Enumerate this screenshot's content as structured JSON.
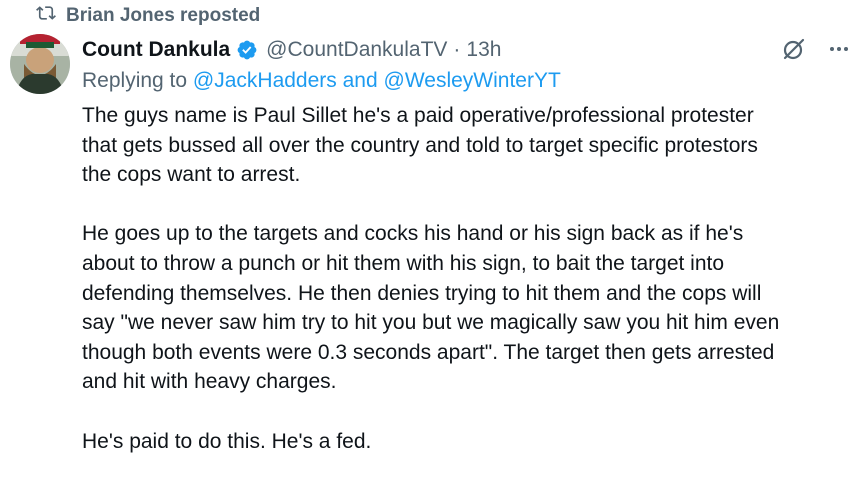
{
  "repost": {
    "icon": "repost-icon",
    "label": "Brian Jones reposted"
  },
  "author": {
    "name": "Count Dankula",
    "verified_icon": "verified-badge-icon",
    "handle": "@CountDankulaTV",
    "separator": "·",
    "time": "13h"
  },
  "header_icons": [
    "grok-icon",
    "more-icon"
  ],
  "reply": {
    "prefix": "Replying to ",
    "user1": "@JackHadders",
    "conjunction": " and ",
    "user2": "@WesleyWinterYT"
  },
  "tweet": {
    "paragraphs": [
      {
        "lines": [
          "The guys name is Paul Sillet he's a paid operative/professional protester",
          "that gets bussed all over the country and told to target specific protestors",
          "the cops want to arrest."
        ]
      },
      {
        "lines": [
          "He goes up to the targets and cocks his hand or his sign back as if he's",
          "about to throw a punch or hit them with his sign, to bait the target into",
          "defending themselves. He then denies trying to hit them and the cops will",
          "say \"we never saw him try to hit you but we magically saw you hit him even",
          "though both events were 0.3 seconds apart\". The target then gets arrested",
          "and hit with heavy charges."
        ]
      },
      {
        "lines": [
          "He's paid to do this. He's a fed."
        ]
      }
    ]
  },
  "colors": {
    "text_primary": "#0f1419",
    "text_secondary": "#536471",
    "link": "#1d9bf0",
    "verified": "#1d9bf0"
  }
}
